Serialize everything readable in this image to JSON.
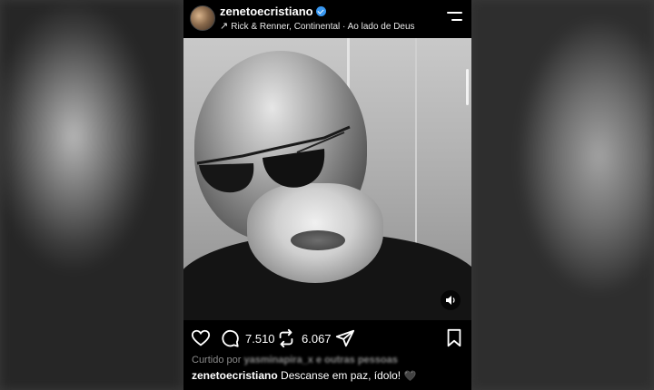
{
  "header": {
    "username": "zenetoecristiano",
    "music_text": "Rick & Renner, Continental · Ao lado de Deus"
  },
  "icons": {
    "avatar": "avatar",
    "verified": "verified-badge-icon",
    "menu": "menu-icon",
    "music": "arrow-icon",
    "sound": "speaker-icon",
    "like": "heart-icon",
    "comment": "comment-icon",
    "repost": "repost-icon",
    "share": "send-icon",
    "save": "bookmark-icon"
  },
  "actions": {
    "comments_count": "7.510",
    "reposts_count": "6.067"
  },
  "liked_by": {
    "prefix": "Curtido por",
    "user": "yasminapira_x e outras pessoas"
  },
  "caption": {
    "user": "zenetoecristiano",
    "text": "Descanse em paz, ídolo!",
    "emoji": "🖤"
  },
  "colors": {
    "verified": "#3897f0",
    "background": "#000000"
  }
}
